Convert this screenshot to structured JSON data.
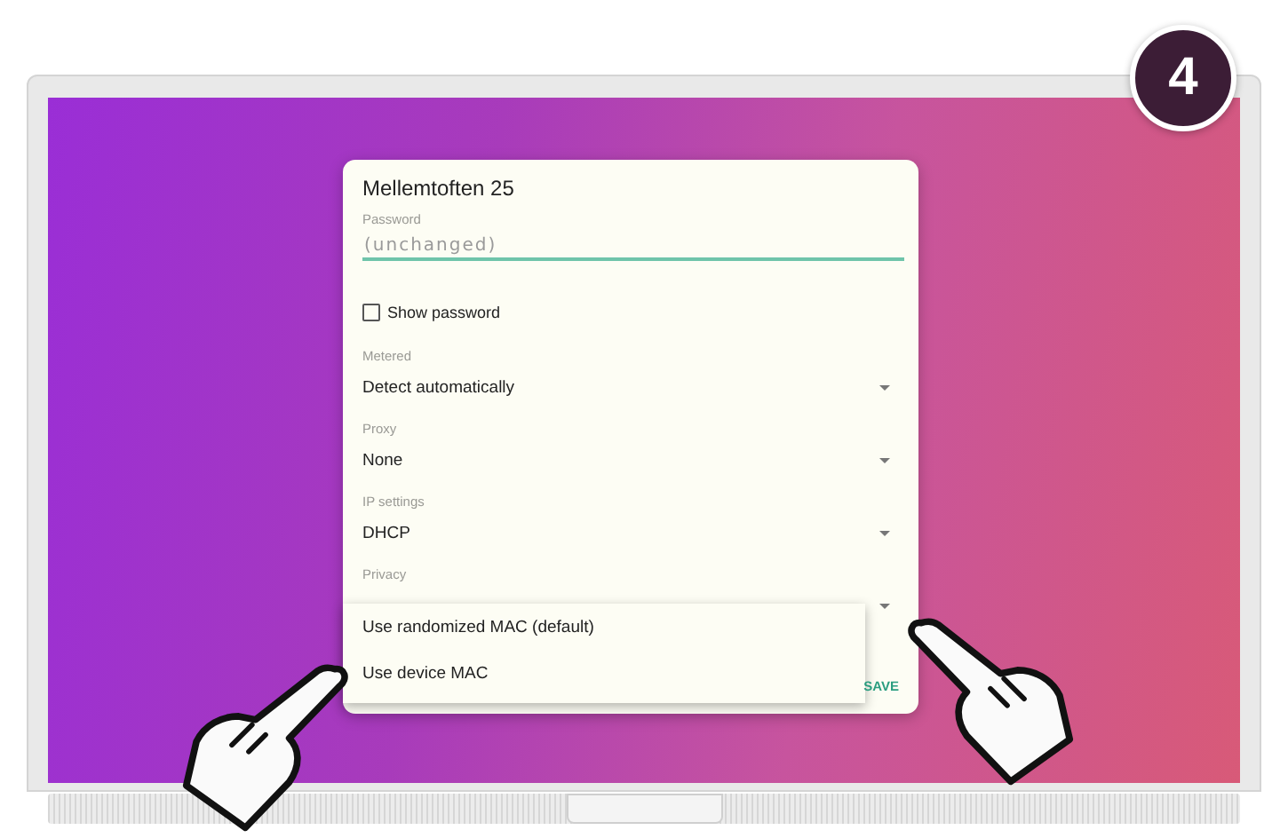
{
  "step_badge": "4",
  "dialog": {
    "title": "Mellemtoften 25",
    "password": {
      "label": "Password",
      "placeholder": "(unchanged)"
    },
    "show_password": {
      "label": "Show password",
      "checked": false
    },
    "fields": [
      {
        "label": "Metered",
        "value": "Detect automatically"
      },
      {
        "label": "Proxy",
        "value": "None"
      },
      {
        "label": "IP settings",
        "value": "DHCP"
      },
      {
        "label": "Privacy"
      }
    ],
    "buttons": [
      "SAVE"
    ]
  },
  "dropdown_menu": {
    "items": [
      {
        "label": "Use randomized MAC (default)",
        "selected": false
      },
      {
        "label": "Use device MAC",
        "selected": false
      }
    ]
  }
}
